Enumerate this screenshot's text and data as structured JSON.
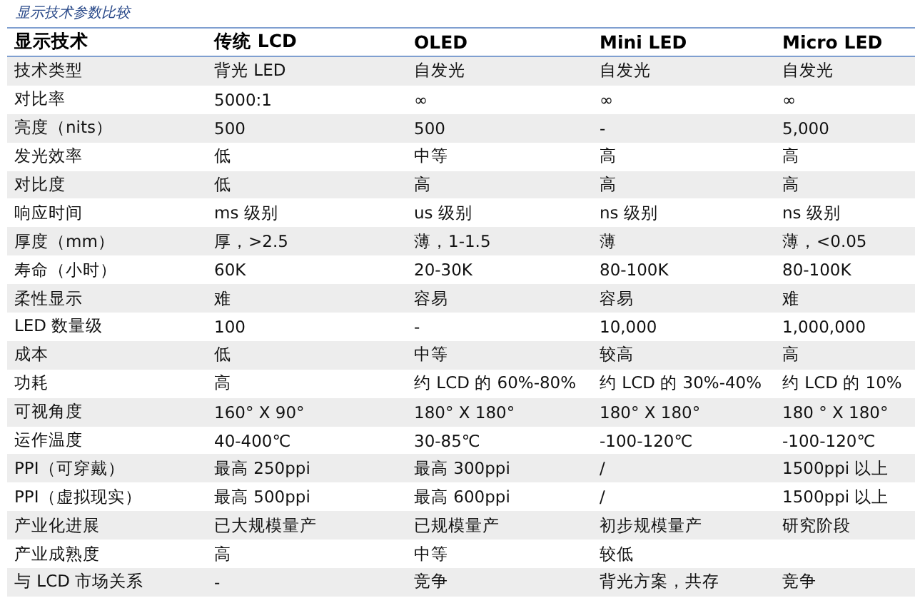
{
  "caption": "显示技术参数比较",
  "table": {
    "columns": [
      "显示技术",
      "传统 LCD",
      "OLED",
      "Mini LED",
      "Micro LED"
    ],
    "rows": [
      [
        "技术类型",
        "背光 LED",
        "自发光",
        "自发光",
        "自发光"
      ],
      [
        "对比率",
        "5000:1",
        "∞",
        "∞",
        "∞"
      ],
      [
        "亮度（nits）",
        "500",
        "500",
        "-",
        "5,000"
      ],
      [
        "发光效率",
        "低",
        "中等",
        "高",
        "高"
      ],
      [
        "对比度",
        "低",
        "高",
        "高",
        "高"
      ],
      [
        "响应时间",
        "ms 级别",
        "us 级别",
        "ns 级别",
        "ns 级别"
      ],
      [
        "厚度（mm）",
        "厚，>2.5",
        "薄，1-1.5",
        "薄",
        "薄，<0.05"
      ],
      [
        "寿命（小时）",
        "60K",
        "20-30K",
        "80-100K",
        "80-100K"
      ],
      [
        "柔性显示",
        "难",
        "容易",
        "容易",
        "难"
      ],
      [
        "LED 数量级",
        "100",
        "-",
        "10,000",
        "1,000,000"
      ],
      [
        "成本",
        "低",
        "中等",
        "较高",
        "高"
      ],
      [
        "功耗",
        "高",
        "约 LCD 的 60%-80%",
        "约 LCD 的 30%-40%",
        "约 LCD 的 10%"
      ],
      [
        "可视角度",
        "160° X 90°",
        "180° X 180°",
        "180° X 180°",
        "180 ° X 180°"
      ],
      [
        "运作温度",
        "40-400℃",
        "30-85℃",
        "-100-120℃",
        "-100-120℃"
      ],
      [
        "PPI（可穿戴）",
        "最高 250ppi",
        "最高 300ppi",
        "/",
        "1500ppi 以上"
      ],
      [
        "PPI（虚拟现实）",
        "最高 500ppi",
        "最高 600ppi",
        "/",
        "1500ppi 以上"
      ],
      [
        "产业化进展",
        "已大规模量产",
        "已规模量产",
        "初步规模量产",
        "研究阶段"
      ],
      [
        "产业成熟度",
        "高",
        "中等",
        "较低"
      ],
      [
        "与 LCD 市场关系",
        "-",
        "竞争",
        "背光方案，共存",
        "竞争"
      ]
    ]
  }
}
